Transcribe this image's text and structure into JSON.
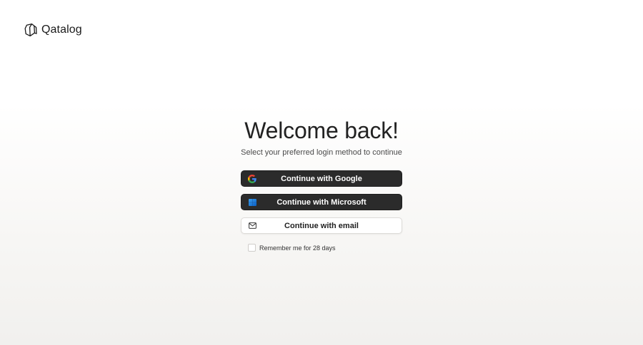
{
  "brand": {
    "name": "Qatalog"
  },
  "login": {
    "title": "Welcome back!",
    "subtitle": "Select your preferred login method to continue",
    "google_label": "Continue with Google",
    "microsoft_label": "Continue with Microsoft",
    "email_label": "Continue with email",
    "remember_label": "Remember me for 28 days",
    "remember_checked": false
  },
  "icons": {
    "logo": "qatalog-logo-icon",
    "google": "google-icon",
    "microsoft": "microsoft-icon",
    "email": "mail-icon"
  },
  "colors": {
    "dark_button": "#2b2b2b",
    "light_button": "#ffffff",
    "text": "#222222"
  }
}
